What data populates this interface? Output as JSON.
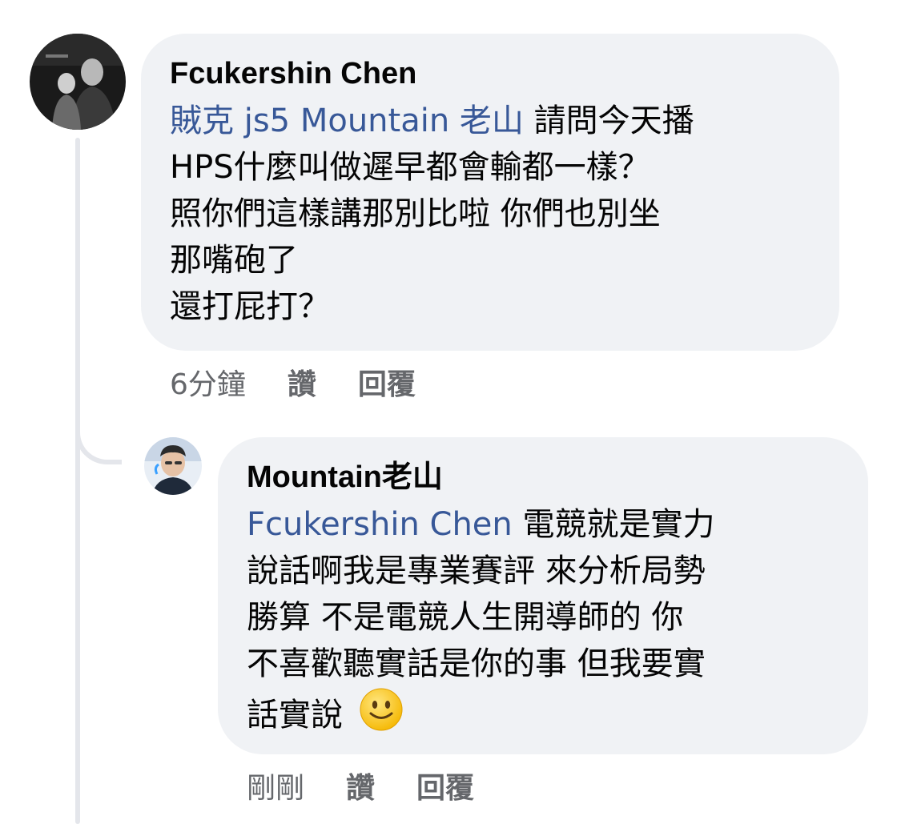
{
  "thread": {
    "comment": {
      "author": "Fcukershin Chen",
      "lines": [
        {
          "mention": "賊克 js5 Mountain 老山",
          "text": " 請問今天播"
        },
        {
          "text": "HPS什麼叫做遲早都會輸都一樣？"
        },
        {
          "text": "照你們這樣講那別比啦 你們也別坐"
        },
        {
          "text": "那嘴砲了"
        },
        {
          "text": "還打屁打？"
        }
      ],
      "timestamp": "6分鐘",
      "like_label": "讚",
      "reply_label": "回覆",
      "avatar_icon": "profile-photo-icon"
    },
    "reply": {
      "author": "Mountain老山",
      "lines": [
        {
          "mention": "Fcukershin Chen",
          "text": " 電競就是實力"
        },
        {
          "text": "說話啊我是專業賽評 來分析局勢"
        },
        {
          "text": "勝算 不是電競人生開導師的 你"
        },
        {
          "text": "不喜歡聽實話是你的事 但我要實"
        },
        {
          "text": "話實說"
        }
      ],
      "emoji": "slightly-smiling-face-icon",
      "timestamp": "剛剛",
      "like_label": "讚",
      "reply_label": "回覆",
      "avatar_icon": "profile-photo-icon"
    }
  },
  "colors": {
    "bubble_bg": "#f0f2f5",
    "mention": "#385898",
    "meta_text": "#65676b",
    "thread_line": "#e4e6eb"
  }
}
